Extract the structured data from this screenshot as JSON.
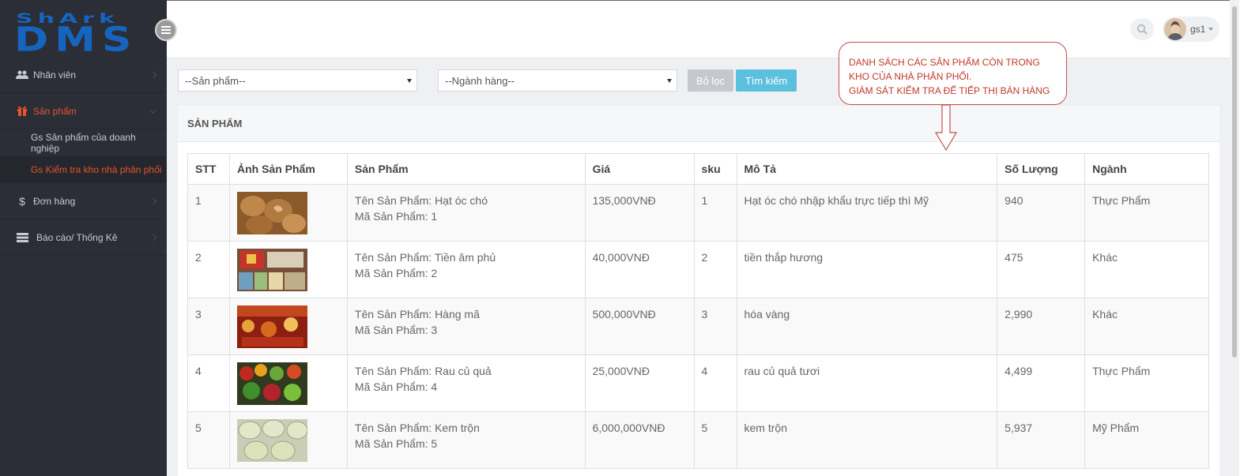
{
  "logo": {
    "line1": "ShArk",
    "line2": "DMS"
  },
  "sidebar": {
    "items": [
      {
        "label": "Nhân viên",
        "icon": "users-icon"
      },
      {
        "label": "Sản phẩm",
        "icon": "gift-icon"
      },
      {
        "label": "Đơn hàng",
        "icon": "dollar-icon"
      },
      {
        "label": "Báo cáo/ Thống Kê",
        "icon": "chart-icon"
      }
    ],
    "sub_items": [
      {
        "label": "Gs Sản phẩm của doanh nghiệp"
      },
      {
        "label": "Gs Kiểm tra kho nhà phân phối"
      }
    ]
  },
  "header": {
    "username": "gs1"
  },
  "filters": {
    "product_select": "--Sản phẩm--",
    "category_select": "--Ngành hàng--",
    "clear_label": "Bỏ lọc",
    "search_label": "Tìm kiếm"
  },
  "callout": {
    "line1": "DANH SÁCH CÁC SẢN PHẨM CÒN TRONG",
    "line2": "KHO CỦA NHÀ PHÂN PHỐI.",
    "line3": "GIÁM SÁT KIỂM TRA ĐỂ TIẾP THỊ BÁN HÀNG"
  },
  "panel": {
    "title": "SẢN PHẨM"
  },
  "table": {
    "headers": [
      "STT",
      "Ảnh Sản Phẩm",
      "Sản Phẩm",
      "Giá",
      "sku",
      "Mô Tả",
      "Số Lượng",
      "Ngành"
    ],
    "rows": [
      {
        "stt": "1",
        "name": "Tên Sản Phẩm: Hạt óc chó",
        "code": "Mã Sản Phẩm: 1",
        "price": "135,000VNĐ",
        "sku": "1",
        "desc": "Hạt óc chó nhập khẩu trực tiếp thì Mỹ",
        "qty": "940",
        "category": "Thực Phẩm"
      },
      {
        "stt": "2",
        "name": "Tên Sản Phẩm: Tiền âm phủ",
        "code": "Mã Sản Phẩm: 2",
        "price": "40,000VNĐ",
        "sku": "2",
        "desc": "tiền thắp hương",
        "qty": "475",
        "category": "Khác"
      },
      {
        "stt": "3",
        "name": "Tên Sản Phẩm: Hàng mã",
        "code": "Mã Sản Phẩm: 3",
        "price": "500,000VNĐ",
        "sku": "3",
        "desc": "hóa vàng",
        "qty": "2,990",
        "category": "Khác"
      },
      {
        "stt": "4",
        "name": "Tên Sản Phẩm: Rau củ quả",
        "code": "Mã Sản Phẩm: 4",
        "price": "25,000VNĐ",
        "sku": "4",
        "desc": "rau củ quả tươi",
        "qty": "4,499",
        "category": "Thực Phẩm"
      },
      {
        "stt": "5",
        "name": "Tên Sản Phẩm: Kem trộn",
        "code": "Mã Sản Phẩm: 5",
        "price": "6,000,000VNĐ",
        "sku": "5",
        "desc": "kem trộn",
        "qty": "5,937",
        "category": "Mỹ Phẩm"
      }
    ]
  },
  "colors": {
    "accent": "#e8532f",
    "sidebar": "#2b2e36",
    "primary_button": "#5bc0de",
    "logo": "#1565c0"
  }
}
